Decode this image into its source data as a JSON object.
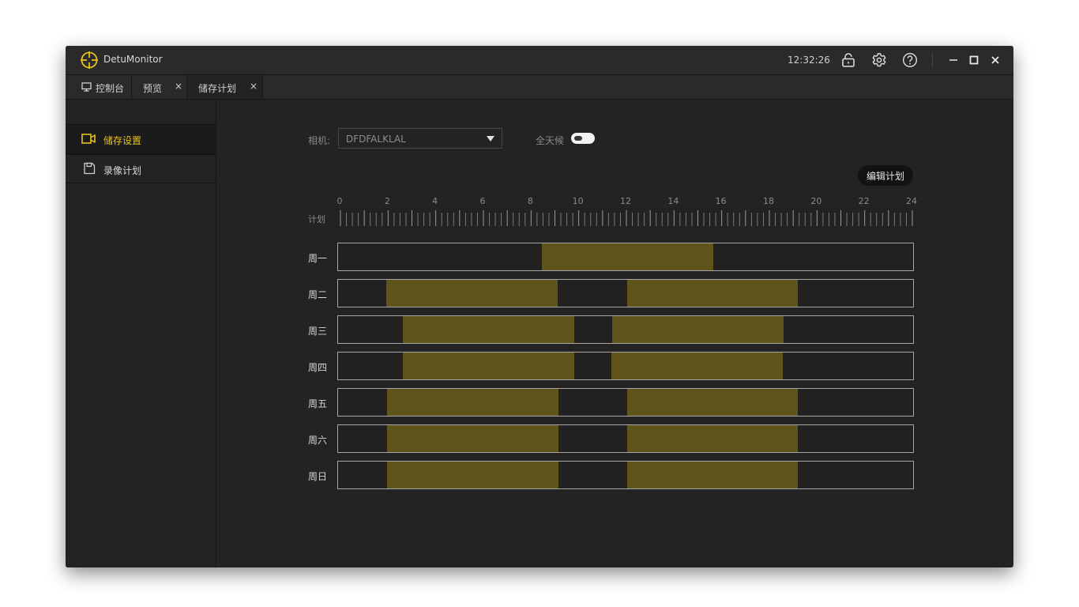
{
  "app": {
    "title": "DetuMonitor",
    "clock": "12:32:26",
    "accent_color": "#e8c21a",
    "schedule_color": "#5f541b",
    "icons": [
      "lock-icon",
      "gear-icon",
      "help-icon",
      "minimize-icon",
      "maximize-icon",
      "close-icon"
    ]
  },
  "tabs": [
    {
      "label": "控制台",
      "icon": "monitor-icon",
      "closable": false
    },
    {
      "label": "预览",
      "closable": true,
      "close_label": "×"
    },
    {
      "label": "储存计划",
      "closable": true,
      "close_label": "×",
      "active": true
    }
  ],
  "sidebar": {
    "items": [
      {
        "label": "储存设置",
        "icon": "camera-icon",
        "active": true
      },
      {
        "label": "录像计划",
        "icon": "save-icon",
        "active": false
      }
    ]
  },
  "form": {
    "camera_label": "相机:",
    "camera_value": "DFDFALKLAL",
    "allday_label": "全天候",
    "allday_on": false,
    "edit_button": "编辑计划"
  },
  "timeline": {
    "plan_label": "计划",
    "hours": [
      "0",
      "2",
      "4",
      "6",
      "8",
      "10",
      "12",
      "14",
      "16",
      "18",
      "20",
      "22",
      "24"
    ],
    "max_hour": 24
  },
  "schedule": [
    {
      "day": "周一",
      "ranges": [
        [
          8.5,
          15.65
        ]
      ]
    },
    {
      "day": "周二",
      "ranges": [
        [
          2.0,
          9.15
        ],
        [
          12.05,
          19.2
        ]
      ]
    },
    {
      "day": "周三",
      "ranges": [
        [
          2.7,
          9.85
        ],
        [
          11.45,
          18.6
        ]
      ]
    },
    {
      "day": "周四",
      "ranges": [
        [
          2.7,
          9.85
        ],
        [
          11.4,
          18.55
        ]
      ]
    },
    {
      "day": "周五",
      "ranges": [
        [
          2.05,
          9.2
        ],
        [
          12.05,
          19.2
        ]
      ]
    },
    {
      "day": "周六",
      "ranges": [
        [
          2.05,
          9.2
        ],
        [
          12.05,
          19.2
        ]
      ]
    },
    {
      "day": "周日",
      "ranges": [
        [
          2.05,
          9.2
        ],
        [
          12.05,
          19.2
        ]
      ]
    }
  ]
}
